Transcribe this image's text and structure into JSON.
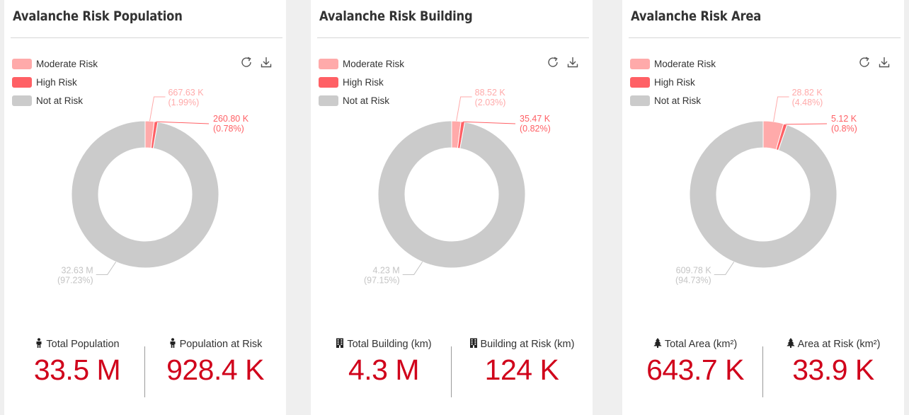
{
  "colors": {
    "moderate": "#ffaaaa",
    "high": "#ff6065",
    "not_at_risk": "#cbcbcb",
    "accent_value": "#d0021b"
  },
  "icons": {
    "refresh": "refresh-icon",
    "download": "download-icon",
    "person": "person-icon",
    "building": "building-icon",
    "tree": "tree-icon"
  },
  "cards": [
    {
      "title": "Avalanche Risk Population",
      "legend": [
        "Moderate Risk",
        "High Risk",
        "Not at Risk"
      ],
      "stats": [
        {
          "label": "Total Population",
          "value": "33.5 M"
        },
        {
          "label": "Population at Risk",
          "value": "928.4 K"
        }
      ]
    },
    {
      "title": "Avalanche Risk Building",
      "legend": [
        "Moderate Risk",
        "High Risk",
        "Not at Risk"
      ],
      "stats": [
        {
          "label": "Total Building (km)",
          "value": "4.3 M"
        },
        {
          "label": "Building at Risk (km)",
          "value": "124 K"
        }
      ]
    },
    {
      "title": "Avalanche Risk Area",
      "legend": [
        "Moderate Risk",
        "High Risk",
        "Not at Risk"
      ],
      "stats": [
        {
          "label": "Total Area (km²)",
          "value": "643.7 K"
        },
        {
          "label": "Area at Risk (km²)",
          "value": "33.9 K"
        }
      ]
    }
  ],
  "chart_data": [
    {
      "type": "pie",
      "variant": "donut",
      "title": "Avalanche Risk Population",
      "legend_position": "top-left",
      "slices": [
        {
          "name": "Moderate Risk",
          "value": 667630,
          "label": "667.63 K",
          "percent_label": "(1.99%)"
        },
        {
          "name": "High Risk",
          "value": 260800,
          "label": "260.80 K",
          "percent_label": "(0.78%)"
        },
        {
          "name": "Not at Risk",
          "value": 32630000,
          "label": "32.63 M",
          "percent_label": "(97.23%)"
        }
      ]
    },
    {
      "type": "pie",
      "variant": "donut",
      "title": "Avalanche Risk Building",
      "legend_position": "top-left",
      "slices": [
        {
          "name": "Moderate Risk",
          "value": 88520,
          "label": "88.52 K",
          "percent_label": "(2.03%)"
        },
        {
          "name": "High Risk",
          "value": 35470,
          "label": "35.47 K",
          "percent_label": "(0.82%)"
        },
        {
          "name": "Not at Risk",
          "value": 4230000,
          "label": "4.23 M",
          "percent_label": "(97.15%)"
        }
      ]
    },
    {
      "type": "pie",
      "variant": "donut",
      "title": "Avalanche Risk Area",
      "legend_position": "top-left",
      "slices": [
        {
          "name": "Moderate Risk",
          "value": 28820,
          "label": "28.82 K",
          "percent_label": "(4.48%)"
        },
        {
          "name": "High Risk",
          "value": 5120,
          "label": "5.12 K",
          "percent_label": "(0.8%)"
        },
        {
          "name": "Not at Risk",
          "value": 609780,
          "label": "609.78 K",
          "percent_label": "(94.73%)"
        }
      ]
    }
  ]
}
